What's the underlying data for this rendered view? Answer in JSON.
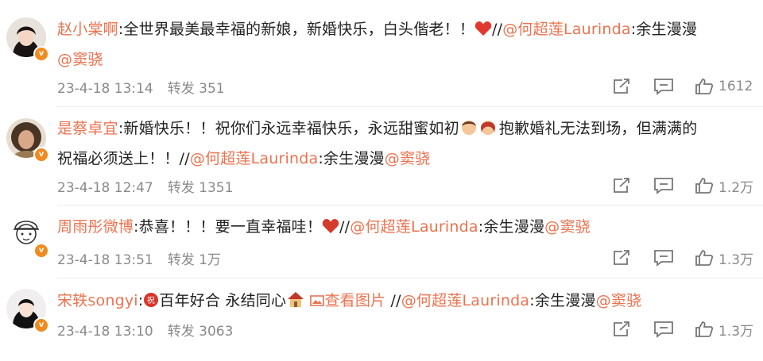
{
  "comments": [
    {
      "name": "赵小棠啊",
      "before": ":全世界最美最幸福的新娘，新婚快乐，白头偕老！！",
      "after_emoji": "//",
      "mention": "@何超莲Laurinda",
      "rest": ":余生漫漫",
      "mention2": "@窦骁",
      "date": "23-4-18 13:14",
      "repost_label": "转发",
      "repost_count": "351",
      "like_count": "1612",
      "emoji": "heart-emoji"
    },
    {
      "name": "是蔡卓宜",
      "before": ":新婚快乐！！祝你们永远幸福快乐，永远甜蜜如初",
      "middle": "抱歉婚礼无法到场，但满满的",
      "line2": "祝福必须送上！！//",
      "mention": "@何超莲Laurinda",
      "rest": ":余生漫漫",
      "mention2": "@窦骁",
      "date": "23-4-18 12:47",
      "repost_label": "转发",
      "repost_count": "1351",
      "like_count": "1.2万",
      "emoji": "couple-emoji"
    },
    {
      "name": "周雨彤微博",
      "before": ":恭喜！！！要一直幸福哇！",
      "after_emoji": "//",
      "mention": "@何超莲Laurinda",
      "rest": ":余生漫漫",
      "mention2": "@窦骁",
      "date": "23-4-18 13:51",
      "repost_label": "转发",
      "repost_count": "1万",
      "like_count": "1.3万",
      "emoji": "heart-emoji"
    },
    {
      "name": "宋轶songyi",
      "before": ":",
      "text2": "百年好合 永结同心",
      "view_image": "查看图片",
      "after": " //",
      "mention": "@何超莲Laurinda",
      "rest": ":余生漫漫",
      "mention2": "@窦骁",
      "date": "23-4-18 13:10",
      "repost_label": "转发",
      "repost_count": "3063",
      "like_count": "1.3万",
      "emoji": "house-emoji",
      "badge_emoji": "bless-emoji"
    }
  ],
  "colors": {
    "accent": "#eb7350",
    "meta": "#8a8a8a",
    "badge": "#f28a1d"
  }
}
